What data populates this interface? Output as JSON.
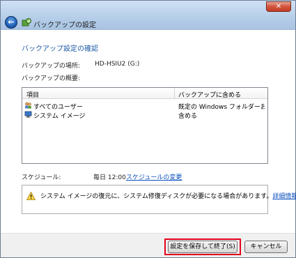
{
  "window": {
    "title": "バックアップの設定",
    "close_glyph": "✕",
    "back_glyph": "←"
  },
  "heading": "バックアップ設定の確認",
  "location": {
    "label": "バックアップの場所:",
    "value": "HD-HSIU2 (G:)"
  },
  "summary_label": "バックアップの概要:",
  "list": {
    "columns": {
      "item": "項目",
      "include": "バックアップに含める"
    },
    "rows": [
      {
        "name": "すべてのユーザー",
        "value": "既定の Windows フォルダーおよ...",
        "icon": "users-icon"
      },
      {
        "name": "システム イメージ",
        "value": "含める",
        "icon": "computer-icon"
      }
    ]
  },
  "schedule": {
    "label": "スケジュール:",
    "value": "毎日 12:00",
    "link": "スケジュールの変更"
  },
  "notice": {
    "text": "システム イメージの復元に、システム修復ディスクが必要になる場合があります。",
    "link": "詳細情報",
    "icon": "warning-icon"
  },
  "buttons": {
    "save": "設定を保存して終了(S)",
    "cancel": "キャンセル"
  },
  "colors": {
    "heading": "#1e5aa8",
    "link": "#0b4fbf",
    "highlight": "#e3001b"
  }
}
